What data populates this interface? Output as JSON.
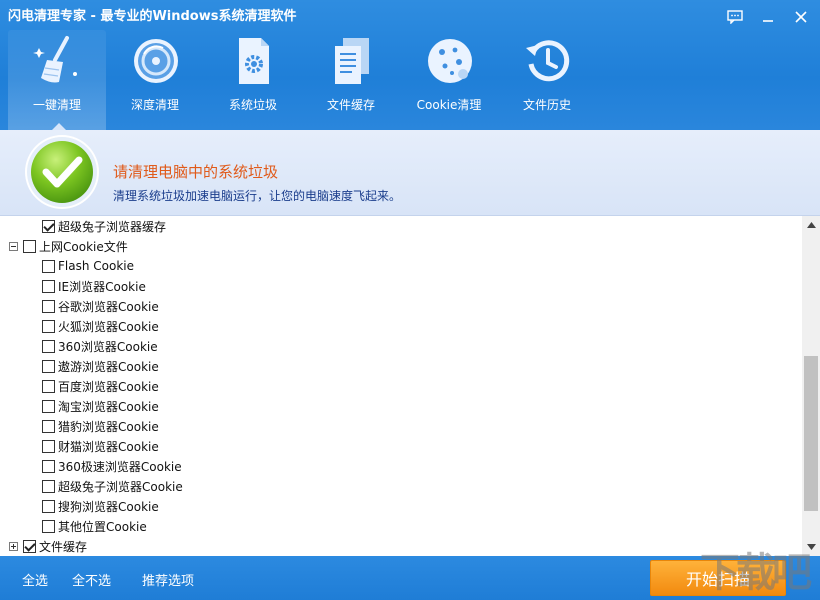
{
  "window": {
    "title": "闪电清理专家 - 最专业的Windows系统清理软件"
  },
  "nav": [
    {
      "label": "一键清理",
      "icon": "broom-icon",
      "active": true
    },
    {
      "label": "深度清理",
      "icon": "disk-icon"
    },
    {
      "label": "系统垃圾",
      "icon": "gear-file-icon"
    },
    {
      "label": "文件缓存",
      "icon": "documents-icon"
    },
    {
      "label": "Cookie清理",
      "icon": "cookie-icon"
    },
    {
      "label": "文件历史",
      "icon": "history-clock-icon"
    }
  ],
  "banner": {
    "title": "请清理电脑中的系统垃圾",
    "subtitle": "清理系统垃圾加速电脑运行，让您的电脑速度飞起来。"
  },
  "tree": [
    {
      "label": "超级兔子浏览器缓存",
      "level": 1,
      "checked": true
    },
    {
      "label": "上网Cookie文件",
      "level": 0,
      "checked": false,
      "toggle": "minus"
    },
    {
      "label": "Flash Cookie",
      "level": 1,
      "checked": false
    },
    {
      "label": "IE浏览器Cookie",
      "level": 1,
      "checked": false
    },
    {
      "label": "谷歌浏览器Cookie",
      "level": 1,
      "checked": false
    },
    {
      "label": "火狐浏览器Cookie",
      "level": 1,
      "checked": false
    },
    {
      "label": "360浏览器Cookie",
      "level": 1,
      "checked": false
    },
    {
      "label": "遨游浏览器Cookie",
      "level": 1,
      "checked": false
    },
    {
      "label": "百度浏览器Cookie",
      "level": 1,
      "checked": false
    },
    {
      "label": "淘宝浏览器Cookie",
      "level": 1,
      "checked": false
    },
    {
      "label": "猎豹浏览器Cookie",
      "level": 1,
      "checked": false
    },
    {
      "label": "财猫浏览器Cookie",
      "level": 1,
      "checked": false
    },
    {
      "label": "360极速浏览器Cookie",
      "level": 1,
      "checked": false
    },
    {
      "label": "超级兔子浏览器Cookie",
      "level": 1,
      "checked": false
    },
    {
      "label": "搜狗浏览器Cookie",
      "level": 1,
      "checked": false
    },
    {
      "label": "其他位置Cookie",
      "level": 1,
      "checked": false
    },
    {
      "label": "文件缓存",
      "level": 0,
      "checked": true,
      "toggle": "plus"
    }
  ],
  "footer": {
    "select_all": "全选",
    "select_none": "全不选",
    "recommended": "推荐选项",
    "scan_button": "开始扫描"
  },
  "watermark": "下载吧"
}
